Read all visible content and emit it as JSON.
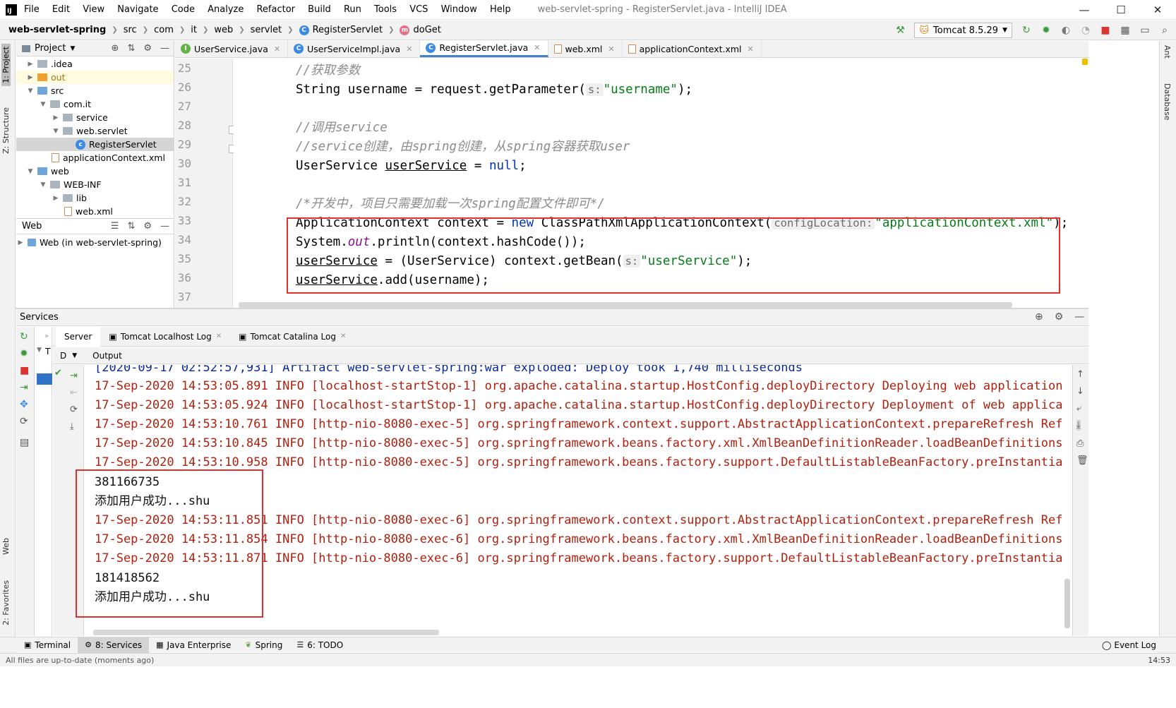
{
  "app": {
    "logo_text": "IJ",
    "title": "web-servlet-spring - RegisterServlet.java - IntelliJ IDEA",
    "menu": [
      "File",
      "Edit",
      "View",
      "Navigate",
      "Code",
      "Analyze",
      "Refactor",
      "Build",
      "Run",
      "Tools",
      "VCS",
      "Window",
      "Help"
    ],
    "window_controls": {
      "minimize": "—",
      "maximize": "☐",
      "close": "✕"
    }
  },
  "breadcrumb": {
    "project": "web-servlet-spring",
    "items": [
      "src",
      "com",
      "it",
      "web",
      "servlet"
    ],
    "class_name": "RegisterServlet",
    "method_name": "doGet"
  },
  "run_config": {
    "label": "Tomcat 8.5.29"
  },
  "left_strip": {
    "project_tab": "1: Project",
    "structure_tab": "Z: Structure",
    "web_tab": "Web",
    "favorites_tab": "2: Favorites"
  },
  "right_strip": {
    "ant": "Ant",
    "database": "Database"
  },
  "project_panel": {
    "title": "Project",
    "items": [
      {
        "label": ".idea",
        "depth": 1,
        "icon": "folder-gray",
        "expanded": false
      },
      {
        "label": "out",
        "depth": 1,
        "icon": "folder-orange",
        "expanded": false
      },
      {
        "label": "src",
        "depth": 1,
        "icon": "folder-blue",
        "expanded": true
      },
      {
        "label": "com.it",
        "depth": 2,
        "icon": "package",
        "expanded": true
      },
      {
        "label": "service",
        "depth": 3,
        "icon": "package",
        "expanded": false
      },
      {
        "label": "web.servlet",
        "depth": 3,
        "icon": "package",
        "expanded": true
      },
      {
        "label": "RegisterServlet",
        "depth": 4,
        "icon": "class",
        "selected": true
      },
      {
        "label": "applicationContext.xml",
        "depth": 2,
        "icon": "xml"
      },
      {
        "label": "web",
        "depth": 1,
        "icon": "folder-web",
        "expanded": true
      },
      {
        "label": "WEB-INF",
        "depth": 2,
        "icon": "folder-gray",
        "expanded": true
      },
      {
        "label": "lib",
        "depth": 3,
        "icon": "folder-gray",
        "expanded": false
      },
      {
        "label": "web.xml",
        "depth": 3,
        "icon": "xml"
      }
    ]
  },
  "web_panel": {
    "title": "Web",
    "items": [
      {
        "label": "Web (in web-servlet-spring)"
      }
    ]
  },
  "editor_tabs": [
    {
      "label": "UserService.java",
      "icon": "I"
    },
    {
      "label": "UserServiceImpl.java",
      "icon": "C"
    },
    {
      "label": "RegisterServlet.java",
      "icon": "C",
      "active": true
    },
    {
      "label": "web.xml",
      "icon": "xml"
    },
    {
      "label": "applicationContext.xml",
      "icon": "xml"
    }
  ],
  "editor": {
    "line_numbers": [
      "25",
      "26",
      "27",
      "28",
      "29",
      "30",
      "31",
      "32",
      "33",
      "34",
      "35",
      "36",
      "37"
    ],
    "lines": {
      "l25": "//获取参数",
      "l26a": "String username = request.getParameter(",
      "l26hint": "s:",
      "l26str": "\"username\"",
      "l26end": ");",
      "l28": "//调用service",
      "l29": "//service创建，由spring创建，从spring容器获取user",
      "l30a": "UserService ",
      "l30b": "userService",
      "l30c": " = ",
      "l30kw": "null",
      "l30end": ";",
      "l32": "/*开发中，项目只需要加载一次spring配置文件即可*/",
      "l33a": "ApplicationContext context = ",
      "l33kw": "new",
      "l33b": " ClassPathXmlApplicationContext(",
      "l33hint": "configLocation:",
      "l33str": "\"applicationContext.xml\"",
      "l33end": ");",
      "l34a": "System.",
      "l34fld": "out",
      "l34b": ".println(context.hashCode());",
      "l35a": "userService",
      "l35b": " = (UserService) context.getBean(",
      "l35hint": "s:",
      "l35str": "\"userService\"",
      "l35end": ");",
      "l36a": "userService",
      "l36b": ".add(username);"
    }
  },
  "services": {
    "title": "Services",
    "tabs": [
      "Server",
      "Tomcat Localhost Log",
      "Tomcat Catalina Log"
    ],
    "deploy_label": "D",
    "output_label": "Output",
    "tree_label": "T",
    "console_lines": [
      {
        "text": "[2020-09-17 02:52:57,931] Artifact web-servlet-spring:war exploded: Deploy took 1,740 milliseconds",
        "color": "info"
      },
      {
        "text": "17-Sep-2020 14:53:05.891 INFO [localhost-startStop-1] org.apache.catalina.startup.HostConfig.deployDirectory Deploying web application",
        "color": "err"
      },
      {
        "text": "17-Sep-2020 14:53:05.924 INFO [localhost-startStop-1] org.apache.catalina.startup.HostConfig.deployDirectory Deployment of web applica",
        "color": "err"
      },
      {
        "text": "17-Sep-2020 14:53:10.761 INFO [http-nio-8080-exec-5] org.springframework.context.support.AbstractApplicationContext.prepareRefresh Ref",
        "color": "err"
      },
      {
        "text": "17-Sep-2020 14:53:10.845 INFO [http-nio-8080-exec-5] org.springframework.beans.factory.xml.XmlBeanDefinitionReader.loadBeanDefinitions",
        "color": "err"
      },
      {
        "text": "17-Sep-2020 14:53:10.958 INFO [http-nio-8080-exec-5] org.springframework.beans.factory.support.DefaultListableBeanFactory.preInstantia",
        "color": "err"
      },
      {
        "text": "381166735",
        "color": "out"
      },
      {
        "text": "添加用户成功...shu",
        "color": "out"
      },
      {
        "text": "17-Sep-2020 14:53:11.851 INFO [http-nio-8080-exec-6] org.springframework.context.support.AbstractApplicationContext.prepareRefresh Ref",
        "color": "err"
      },
      {
        "text": "17-Sep-2020 14:53:11.854 INFO [http-nio-8080-exec-6] org.springframework.beans.factory.xml.XmlBeanDefinitionReader.loadBeanDefinitions",
        "color": "err"
      },
      {
        "text": "17-Sep-2020 14:53:11.871 INFO [http-nio-8080-exec-6] org.springframework.beans.factory.support.DefaultListableBeanFactory.preInstantia",
        "color": "err"
      },
      {
        "text": "181418562",
        "color": "out"
      },
      {
        "text": "添加用户成功...shu",
        "color": "out"
      }
    ]
  },
  "bottom_tabs": [
    {
      "label": "Terminal"
    },
    {
      "label": "8: Services",
      "selected": true
    },
    {
      "label": "Java Enterprise"
    },
    {
      "label": "Spring"
    },
    {
      "label": "6: TODO"
    }
  ],
  "event_log": "Event Log",
  "status_text": "All files are up-to-date (moments ago)",
  "clock": "14:53",
  "colors": {
    "accent": "#4083c9",
    "highlight_box": "#e03030",
    "console_info": "#b0200f"
  }
}
